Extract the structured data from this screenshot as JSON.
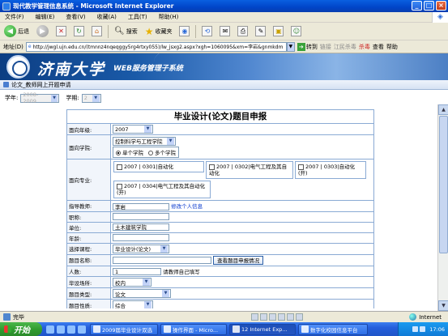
{
  "window": {
    "title": "现代教学管理信息系统 - Microsoft Internet Explorer",
    "minimize": "_",
    "maximize": "□",
    "close": "×"
  },
  "menu": [
    "文件(F)",
    "编辑(E)",
    "查看(V)",
    "收藏(A)",
    "工具(T)",
    "帮助(H)"
  ],
  "toolbar": {
    "back": "后退",
    "search": "搜索",
    "favorites": "收藏夹"
  },
  "addressbar": {
    "label": "地址(D)",
    "url": "http://jwgl.ujn.edu.cn/(tmnnz4nqeqggy5rg4rtxy055)/lw_jsxg2.aspx?xgh=1060095&xm=李岩&gnmkdm",
    "go": "转到",
    "links": "链接",
    "jiangmin": "江民杀毒",
    "killvirus": "杀毒",
    "search": "查看",
    "help": "帮助"
  },
  "banner": {
    "university": "济南大学",
    "system": "WEB服务管理子系统"
  },
  "breadcrumb": "论文_教师网上开题申请",
  "filter": {
    "year_label": "学年:",
    "year_value": "2008-2009",
    "term_label": "学期:",
    "term_value": "2"
  },
  "form": {
    "title": "毕业设计(论文)题目申报",
    "grade_label": "面向年级:",
    "grade_value": "2007",
    "college_label": "面向学院:",
    "college_value": "控制科学与工程学院",
    "single_college": "单个学院",
    "multi_college": "多个学院",
    "major_label": "面向专业:",
    "majors": [
      "2007 | 0301|自动化",
      "2007 | 0302|电气工程及其自动化",
      "2007 | 0303|自动化(开)",
      "2007 | 0304|电气工程及其自动化(开)"
    ],
    "advisor_label": "指导教师:",
    "advisor_value": "李岩",
    "edit_info": "修改个人信息",
    "title_rank_label": "职称:",
    "title_rank_value": "",
    "unit_label": "单位:",
    "unit_value": "土木建筑学院",
    "age_label": "年龄:",
    "age_value": "",
    "course_label": "选择课程:",
    "course_value": "毕业设计(论文)",
    "topic_label": "题目名称:",
    "topic_value": "",
    "view_topics": "查看题目申报情况",
    "people_label": "人数:",
    "people_value": "1",
    "people_hint": "请教师自己填写",
    "venue_label": "毕设场所:",
    "venue_value": "校内",
    "type_label": "题目类型:",
    "type_value": "论文",
    "nature_label": "题目性质:",
    "nature_value": "综合"
  },
  "status": {
    "text": "完毕",
    "zone": "Internet"
  },
  "taskbar": {
    "start": "开始",
    "tasks": [
      "2009届毕业设计双选",
      "操作界面 - Micro...",
      "12 Internet Exp...",
      "数字化校园信息平台"
    ],
    "clock": "17:06"
  }
}
